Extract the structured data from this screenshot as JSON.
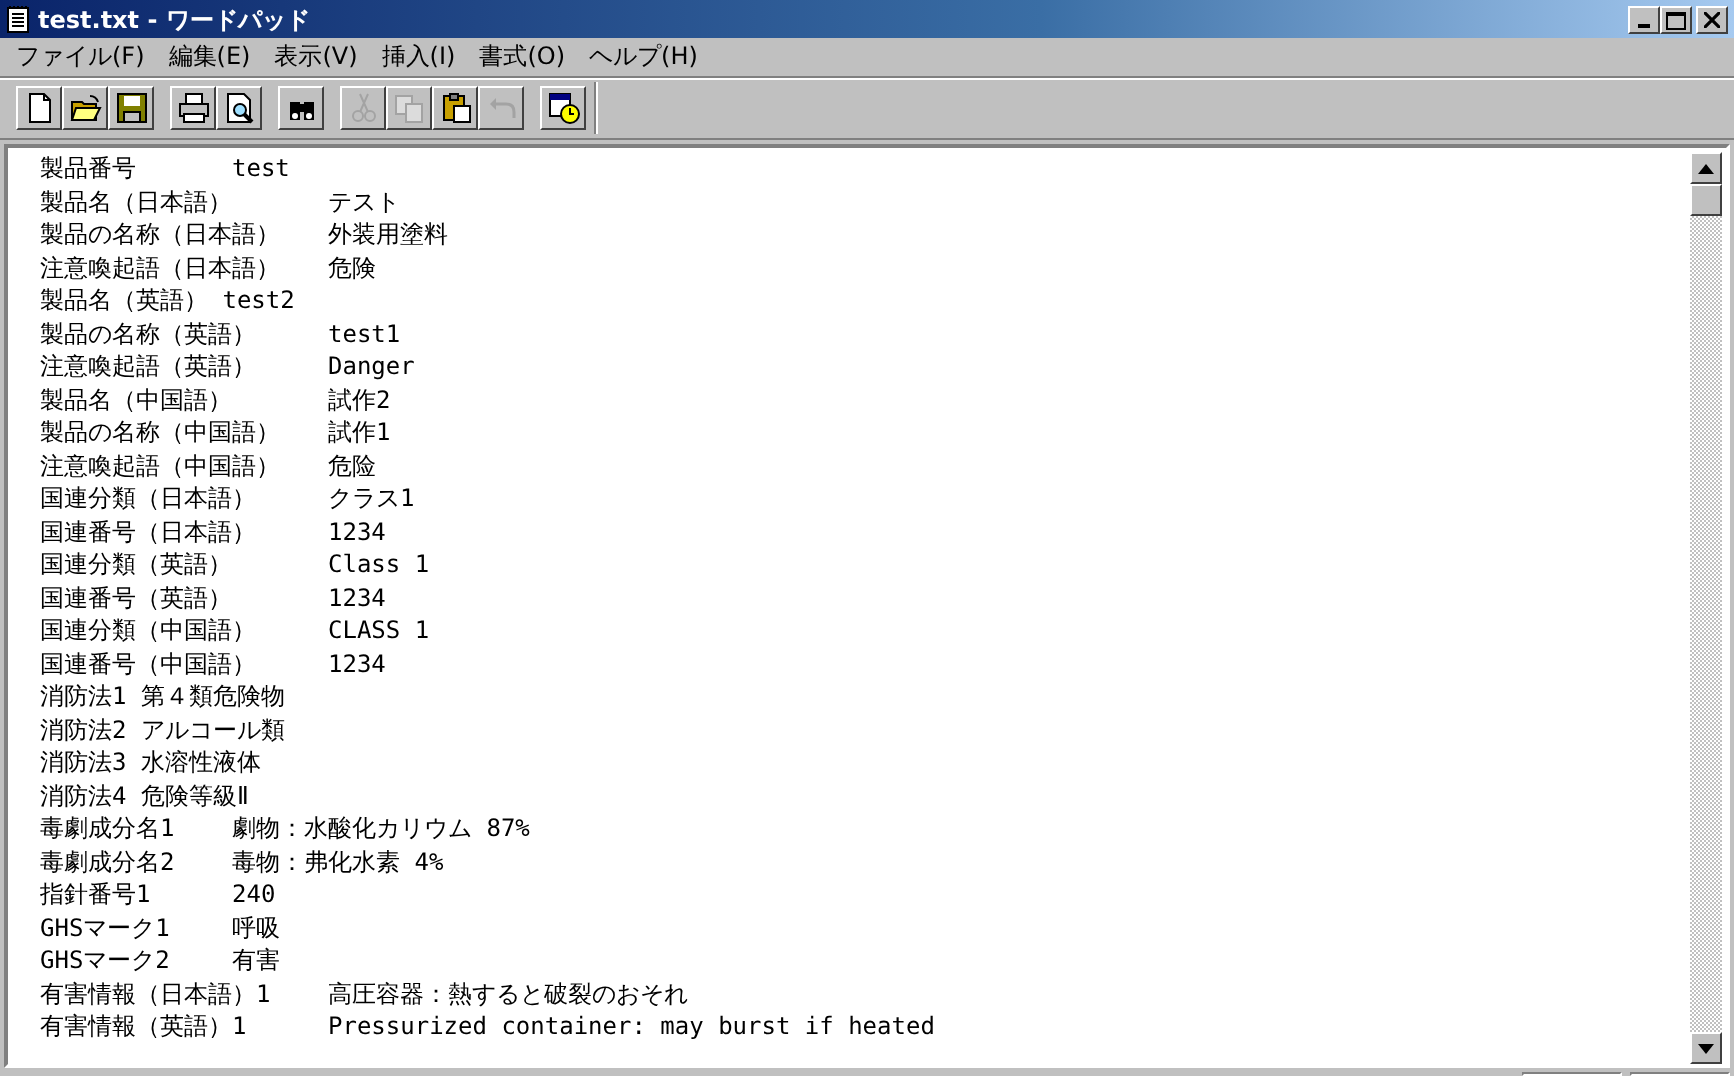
{
  "window": {
    "title": "test.txt - ワードパッド"
  },
  "menu": [
    {
      "label": "ファイル(F)"
    },
    {
      "label": "編集(E)"
    },
    {
      "label": "表示(V)"
    },
    {
      "label": "挿入(I)"
    },
    {
      "label": "書式(O)"
    },
    {
      "label": "ヘルプ(H)"
    }
  ],
  "toolbar": [
    {
      "buttons": [
        {
          "kind": "new",
          "disabled": false
        },
        {
          "kind": "open",
          "disabled": false
        },
        {
          "kind": "save",
          "disabled": false
        }
      ]
    },
    {
      "buttons": [
        {
          "kind": "print",
          "disabled": false
        },
        {
          "kind": "preview",
          "disabled": false
        }
      ]
    },
    {
      "buttons": [
        {
          "kind": "find",
          "disabled": false
        }
      ]
    },
    {
      "buttons": [
        {
          "kind": "cut",
          "disabled": true
        },
        {
          "kind": "copy",
          "disabled": true
        },
        {
          "kind": "paste",
          "disabled": false
        },
        {
          "kind": "undo",
          "disabled": true
        }
      ]
    },
    {
      "buttons": [
        {
          "kind": "datetime",
          "disabled": false
        }
      ]
    }
  ],
  "document": {
    "lines": [
      "製品番号\ttest",
      "製品名（日本語）\tテスト",
      "製品の名称（日本語）\t外装用塗料",
      "注意喚起語（日本語）\t危険",
      "製品名（英語） test2",
      "製品の名称（英語）\ttest1",
      "注意喚起語（英語）\tDanger",
      "製品名（中国語）\t試作2",
      "製品の名称（中国語）\t試作1",
      "注意喚起語（中国語）\t危险",
      "国連分類（日本語）\tクラス1",
      "国連番号（日本語）\t1234",
      "国連分類（英語）\tClass 1",
      "国連番号（英語）\t1234",
      "国連分類（中国語）\tCLASS 1",
      "国連番号（中国語）\t1234",
      "消防法1 第４類危険物",
      "消防法2 アルコール類",
      "消防法3 水溶性液体",
      "消防法4 危険等級Ⅱ",
      "毒劇成分名1\t劇物：水酸化カリウム 87%",
      "毒劇成分名2\t毒物：弗化水素 4%",
      "指針番号1\t240",
      "GHSマーク1\t呼吸",
      "GHSマーク2\t有害",
      "有害情報（日本語）1\t高圧容器：熱すると破裂のおそれ",
      "有害情報（英語）1\tPressurized container: may burst if heated"
    ]
  }
}
